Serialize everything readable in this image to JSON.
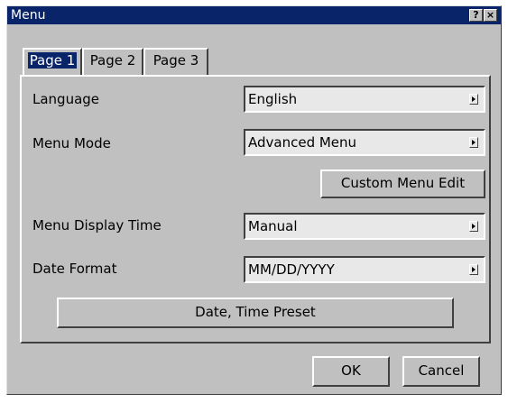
{
  "window": {
    "title": "Menu",
    "help_label": "?",
    "close_label": "×"
  },
  "tabs": [
    {
      "label": "Page 1",
      "active": true
    },
    {
      "label": "Page 2",
      "active": false
    },
    {
      "label": "Page 3",
      "active": false
    }
  ],
  "settings": {
    "language": {
      "label": "Language",
      "value": "English"
    },
    "menu_mode": {
      "label": "Menu Mode",
      "value": "Advanced Menu"
    },
    "custom_menu_edit": "Custom Menu Edit",
    "menu_display_time": {
      "label": "Menu Display Time",
      "value": "Manual"
    },
    "date_format": {
      "label": "Date Format",
      "value": "MM/DD/YYYY"
    },
    "date_time_preset": "Date, Time Preset"
  },
  "footer": {
    "ok_label": "OK",
    "cancel_label": "Cancel"
  },
  "colors": {
    "titlebar": "#0a246a",
    "face": "#c0c0c0",
    "selected_tab": "#0a246a"
  }
}
